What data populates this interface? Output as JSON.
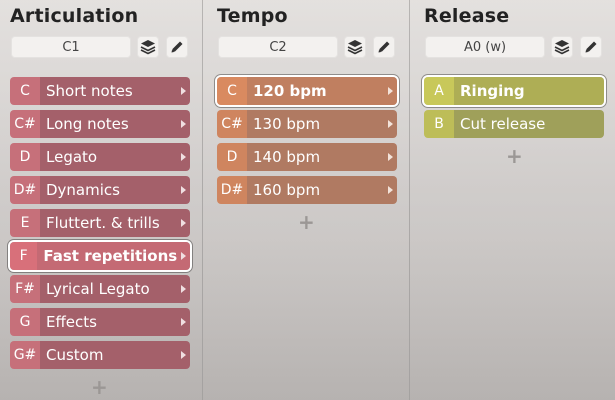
{
  "columns": [
    {
      "title": "Articulation",
      "key_field": "C1",
      "items": [
        {
          "key": "C",
          "label": "Short notes"
        },
        {
          "key": "C#",
          "label": "Long notes"
        },
        {
          "key": "D",
          "label": "Legato"
        },
        {
          "key": "D#",
          "label": "Dynamics"
        },
        {
          "key": "E",
          "label": "Fluttert. & trills"
        },
        {
          "key": "F",
          "label": "Fast repetitions",
          "selected": true
        },
        {
          "key": "F#",
          "label": "Lyrical Legato"
        },
        {
          "key": "G",
          "label": "Effects"
        },
        {
          "key": "G#",
          "label": "Custom"
        }
      ],
      "add_label": "+"
    },
    {
      "title": "Tempo",
      "key_field": "C2",
      "items": [
        {
          "key": "C",
          "label": "120 bpm",
          "selected": true
        },
        {
          "key": "C#",
          "label": "130 bpm"
        },
        {
          "key": "D",
          "label": "140 bpm"
        },
        {
          "key": "D#",
          "label": "160 bpm"
        }
      ],
      "add_label": "+"
    },
    {
      "title": "Release",
      "key_field": "A0 (w)",
      "items": [
        {
          "key": "A",
          "label": "Ringing",
          "selected": true
        },
        {
          "key": "B",
          "label": "Cut release"
        }
      ],
      "add_label": "+"
    }
  ],
  "icons": {
    "layers": "layers-icon",
    "edit": "pencil-icon",
    "expand": "chevron-right-icon",
    "add": "plus-icon"
  },
  "colors": {
    "articulation": "#a4606a",
    "tempo": "#b07a62",
    "release": "#9fa05a",
    "selection_outline": "#ffffff"
  }
}
